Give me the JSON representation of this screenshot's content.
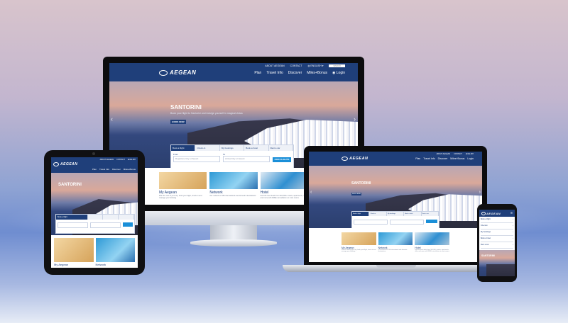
{
  "brand": {
    "name": "AEGEAN",
    "navy": "#1f3f7a",
    "accent": "#1a8fd8"
  },
  "topbar": {
    "links": [
      "ABOUT AEGEAN",
      "CONTACT",
      "ENGLISH"
    ],
    "search_placeholder": "search"
  },
  "nav": {
    "items": [
      "Plan",
      "Travel Info",
      "Discover",
      "Miles+Bonus"
    ],
    "login": "Login"
  },
  "hero": {
    "title": "SANTORINI",
    "subtitle": "Book your flight to Santorini and indulge yourself in magical vistas",
    "button": "BOOK NOW"
  },
  "booking": {
    "tabs": [
      "Book a flight",
      "Check-in",
      "My bookings",
      "Book a hotel",
      "Rent a car"
    ],
    "from_label": "From",
    "from_placeholder": "Departure City or Airport",
    "to_label": "To",
    "to_placeholder": "Arrival City or Airport",
    "search": "FIND FLIGHTS"
  },
  "cards": [
    {
      "title": "My Aegean",
      "desc": "Plan the rest of your trip, book your flight, check-in and manage your booking"
    },
    {
      "title": "Network",
      "desc": "Our network of 156 international and domestic destinations"
    },
    {
      "title": "Hotel",
      "desc": "Find the best deals from 500,000+ hotels, apartments, villas and more with FREE cancellation on most rooms"
    }
  ],
  "mobile_menu": [
    "Book a flight",
    "Check-in",
    "My bookings",
    "Book a hotel",
    "Rent a car"
  ],
  "icons": {
    "logo": "aegean-bird-logo-icon",
    "globe": "globe-icon",
    "login": "user-icon",
    "menu": "hamburger-icon",
    "prev": "chevron-left-icon",
    "next": "chevron-right-icon"
  }
}
